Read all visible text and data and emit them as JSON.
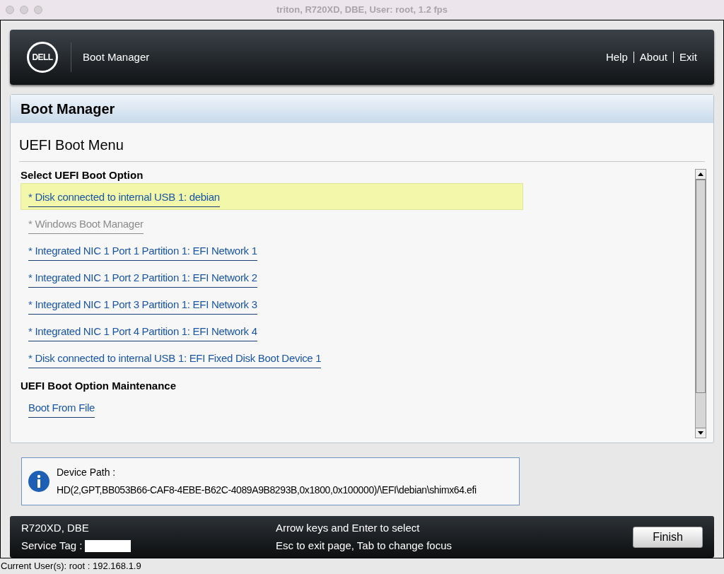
{
  "window": {
    "title": "triton, R720XD, DBE, User: root, 1.2 fps"
  },
  "header": {
    "logo": "DELL",
    "title": "Boot Manager",
    "links": [
      "Help",
      "About",
      "Exit"
    ]
  },
  "page": {
    "title": "Boot Manager",
    "subtitle": "UEFI Boot Menu",
    "sections": [
      {
        "heading": "Select UEFI Boot Option",
        "items": [
          {
            "label": "* Disk connected to internal USB 1: debian",
            "selected": true,
            "disabled": false
          },
          {
            "label": "* Windows Boot Manager",
            "selected": false,
            "disabled": true
          },
          {
            "label": "* Integrated NIC 1 Port 1 Partition 1: EFI Network 1",
            "selected": false,
            "disabled": false
          },
          {
            "label": "* Integrated NIC 1 Port 2 Partition 1: EFI Network 2",
            "selected": false,
            "disabled": false
          },
          {
            "label": "* Integrated NIC 1 Port 3 Partition 1: EFI Network 3",
            "selected": false,
            "disabled": false
          },
          {
            "label": "* Integrated NIC 1 Port 4 Partition 1: EFI Network 4",
            "selected": false,
            "disabled": false
          },
          {
            "label": "* Disk connected to internal USB 1: EFI Fixed Disk Boot Device 1",
            "selected": false,
            "disabled": false
          }
        ]
      },
      {
        "heading": "UEFI Boot Option Maintenance",
        "items": [
          {
            "label": "Boot From File",
            "selected": false,
            "disabled": false
          }
        ]
      }
    ]
  },
  "info": {
    "label": "Device Path :",
    "value": "HD(2,GPT,BB053B66-CAF8-4EBE-B62C-4089A9B8293B,0x1800,0x100000)/\\EFI\\debian\\shimx64.efi"
  },
  "footer": {
    "system": "R720XD, DBE",
    "service_tag_label": "Service Tag :",
    "hints": [
      "Arrow keys and Enter to select",
      "Esc to exit page, Tab to change focus"
    ],
    "button": "Finish"
  },
  "status_bar": "Current User(s): root : 192.168.1.9"
}
